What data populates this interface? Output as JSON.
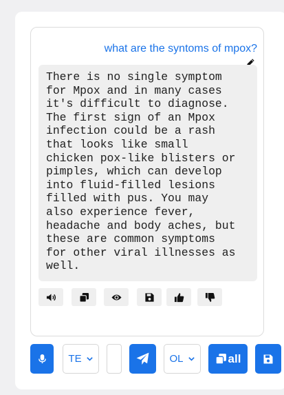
{
  "chat": {
    "question": "what are the syntoms of mpox?",
    "answer": "There is no single symptom\nfor Mpox and in many cases\nit's difficult to diagnose.\nThe first sign of an Mpox\ninfection could be a rash\nthat looks like small\nchicken pox-like blisters or\npimples, which can develop\ninto fluid-filled lesions\nfilled with pus. You may\nalso experience fever,\nheadache and body aches, but\nthese are common symptoms\nfor other viral illnesses as\nwell."
  },
  "answer_actions": [
    "speaker-icon",
    "copy-icon",
    "eye-icon",
    "save-icon",
    "thumbs-up-icon",
    "thumbs-down-icon"
  ],
  "input_bar": {
    "language_select": "TE",
    "message_input": "",
    "output_select": "OL",
    "copy_all_label": "all"
  },
  "colors": {
    "accent": "#1a73e8",
    "answer_bg": "#efefef",
    "page_bg": "#f0f0f2"
  }
}
